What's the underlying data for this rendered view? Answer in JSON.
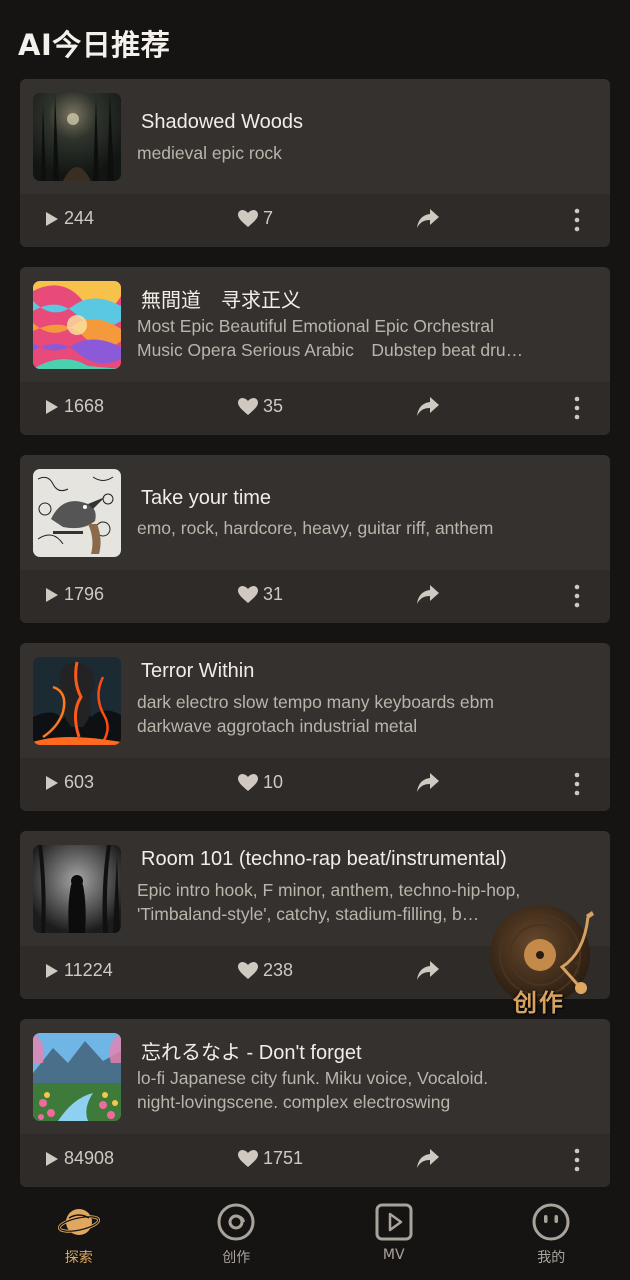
{
  "header": {
    "title": "AI今日推荐"
  },
  "songs": [
    {
      "title": "Shadowed Woods",
      "desc_lines": [
        "medieval epic rock"
      ],
      "plays": "244",
      "likes": "7"
    },
    {
      "title": "無間道　寻求正义",
      "desc_lines": [
        "Most Epic Beautiful Emotional Epic Orchestral",
        "Music Opera Serious Arabic　Dubstep beat dru…"
      ],
      "plays": "1668",
      "likes": "35"
    },
    {
      "title": "Take your time",
      "desc_lines": [
        "emo, rock, hardcore, heavy, guitar riff, anthem"
      ],
      "plays": "1796",
      "likes": "31"
    },
    {
      "title": "Terror Within",
      "desc_lines": [
        "dark electro slow tempo many keyboards ebm",
        "darkwave aggrotach industrial metal"
      ],
      "plays": "603",
      "likes": "10"
    },
    {
      "title": "Room 101 (techno-rap beat/instrumental)",
      "desc_lines": [
        "Epic intro hook, F minor, anthem, techno-hip-hop,",
        "'Timbaland-style', catchy, stadium-filling, b…"
      ],
      "plays": "11224",
      "likes": "238"
    },
    {
      "title": "忘れるなよ - Don't forget",
      "desc_lines": [
        "lo-fi Japanese city funk. Miku voice, Vocaloid.",
        "night-lovingscene. complex electroswing"
      ],
      "plays": "84908",
      "likes": "1751"
    }
  ],
  "fab": {
    "label": "创作",
    "icon": "vinyl-record-icon"
  },
  "tabbar": {
    "tabs": [
      {
        "label": "探索",
        "icon": "planet-icon",
        "active": true
      },
      {
        "label": "创作",
        "icon": "disc-icon",
        "active": false
      },
      {
        "label": "MV",
        "icon": "video-play-icon",
        "active": false
      },
      {
        "label": "我的",
        "icon": "smiley-icon",
        "active": false
      }
    ]
  },
  "colors": {
    "accent": "#e0a761",
    "card": "#34312e",
    "background": "#151413"
  }
}
